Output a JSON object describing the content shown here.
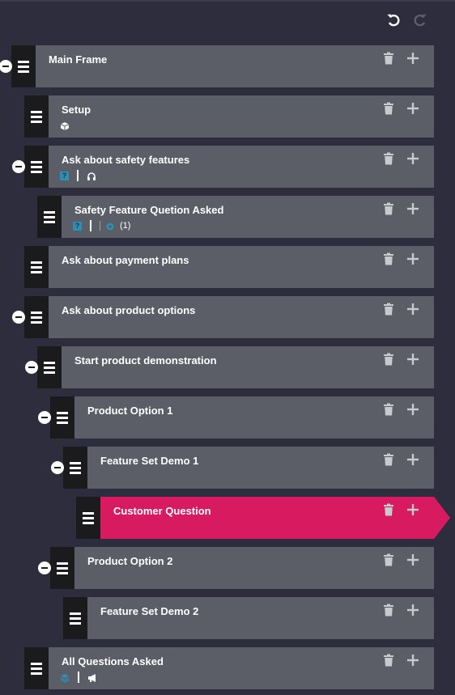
{
  "colors": {
    "background": "#2d2d3e",
    "node": "#5b5e66",
    "handle": "#1b1b1d",
    "active": "#d81b60",
    "chip": "#2d8fb4"
  },
  "toolbar": {
    "undo_icon": "undo-icon",
    "redo_icon": "redo-icon"
  },
  "nodes": [
    {
      "label": "Main Frame",
      "depth": 0,
      "collapsible": true
    },
    {
      "label": "Setup",
      "depth": 1,
      "collapsible": false,
      "chips": [
        "cube-icon"
      ]
    },
    {
      "label": "Ask about safety features",
      "depth": 1,
      "collapsible": true,
      "chips": [
        "question-icon",
        "headphones-icon"
      ]
    },
    {
      "label": "Safety Feature Quetion Asked",
      "depth": 2,
      "collapsible": false,
      "chips": [
        "question-icon",
        "gear-icon"
      ],
      "count": "(1)"
    },
    {
      "label": "Ask about payment plans",
      "depth": 1,
      "collapsible": false
    },
    {
      "label": "Ask about product options",
      "depth": 1,
      "collapsible": true
    },
    {
      "label": "Start product demonstration",
      "depth": 2,
      "collapsible": true
    },
    {
      "label": "Product Option 1",
      "depth": 3,
      "collapsible": true
    },
    {
      "label": "Feature Set Demo 1",
      "depth": 4,
      "collapsible": true
    },
    {
      "label": "Customer Question",
      "depth": 5,
      "collapsible": false,
      "active": true
    },
    {
      "label": "Product Option 2",
      "depth": 3,
      "collapsible": true
    },
    {
      "label": "Feature Set Demo 2",
      "depth": 4,
      "collapsible": false
    },
    {
      "label": "All Questions Asked",
      "depth": 1,
      "collapsible": false,
      "chips": [
        "layers-icon",
        "megaphone-icon"
      ]
    }
  ]
}
